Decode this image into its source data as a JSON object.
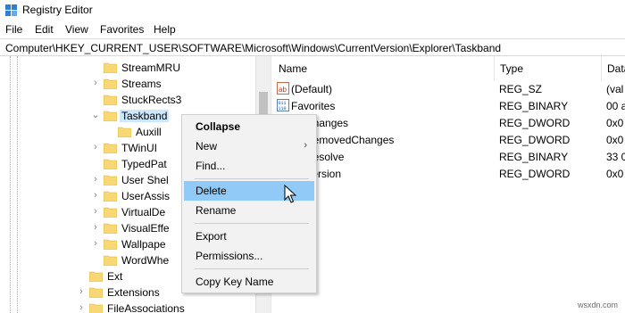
{
  "window": {
    "title": "Registry Editor"
  },
  "menu": [
    "File",
    "Edit",
    "View",
    "Favorites",
    "Help"
  ],
  "address": "Computer\\HKEY_CURRENT_USER\\SOFTWARE\\Microsoft\\Windows\\CurrentVersion\\Explorer\\Taskband",
  "tree": {
    "items": [
      {
        "label": "StreamMRU"
      },
      {
        "label": "Streams"
      },
      {
        "label": "StuckRects3"
      },
      {
        "label": "Taskband"
      },
      {
        "label": "Auxill"
      },
      {
        "label": "TWinUI"
      },
      {
        "label": "TypedPat"
      },
      {
        "label": "User Shel"
      },
      {
        "label": "UserAssis"
      },
      {
        "label": "VirtualDe"
      },
      {
        "label": "VisualEffe"
      },
      {
        "label": "Wallpape"
      },
      {
        "label": "WordWhe"
      },
      {
        "label": "Ext"
      },
      {
        "label": "Extensions"
      },
      {
        "label": "FileAssociations"
      }
    ]
  },
  "list": {
    "columns": [
      "Name",
      "Type",
      "Data"
    ],
    "rows": [
      {
        "name": "(Default)",
        "type": "REG_SZ",
        "data": "(val"
      },
      {
        "name": "Favorites",
        "type": "REG_BINARY",
        "data": "00 a"
      },
      {
        "name": "tesChanges",
        "type": "REG_DWORD",
        "data": "0x0"
      },
      {
        "name": "tesRemovedChanges",
        "type": "REG_DWORD",
        "data": "0x0"
      },
      {
        "name": "tesResolve",
        "type": "REG_BINARY",
        "data": "33 0"
      },
      {
        "name": "tesVersion",
        "type": "REG_DWORD",
        "data": "0x0"
      }
    ]
  },
  "context_menu": {
    "collapse": "Collapse",
    "new": "New",
    "find": "Find...",
    "delete": "Delete",
    "rename": "Rename",
    "export": "Export",
    "permissions": "Permissions...",
    "copy_key_name": "Copy Key Name"
  },
  "watermark": "wsxdn.com",
  "colors": {
    "highlight": "#91c9f7",
    "selection": "#cce8ff",
    "folder": "#f8d775"
  }
}
